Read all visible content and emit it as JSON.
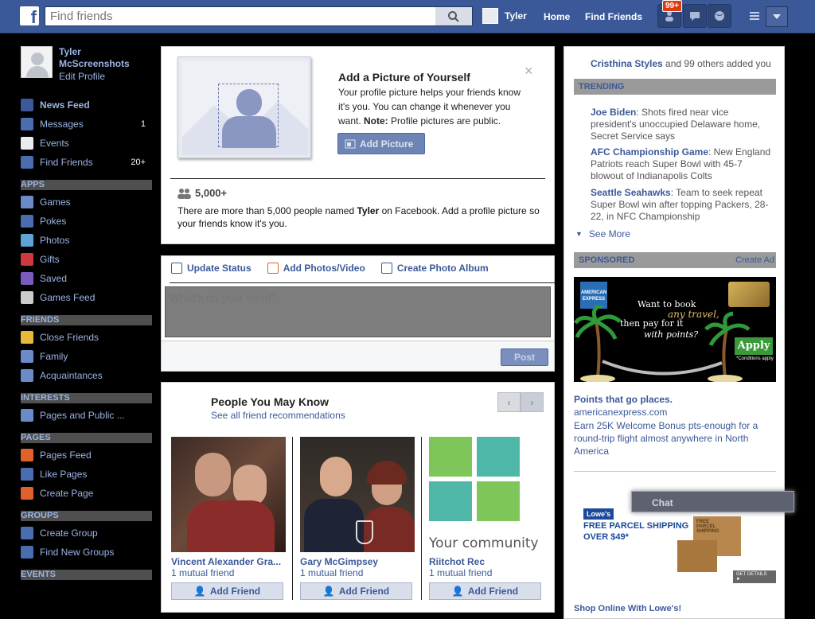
{
  "topbar": {
    "logo": "f",
    "search_placeholder": "Find friends",
    "user_name": "Tyler",
    "home": "Home",
    "find_friends": "Find Friends",
    "notif_count": "99+"
  },
  "sidebar": {
    "profile_name": "Tyler McScreenshots",
    "edit_profile": "Edit Profile",
    "main": [
      {
        "label": "News Feed",
        "count": "",
        "icon": "news-feed-icon",
        "color": "#3b5998"
      },
      {
        "label": "Messages",
        "count": "1",
        "icon": "messages-icon",
        "color": "#4a6db0"
      },
      {
        "label": "Events",
        "count": "",
        "icon": "events-icon",
        "color": "#e9ebee"
      },
      {
        "label": "Find Friends",
        "count": "20+",
        "icon": "find-friends-icon",
        "color": "#4a6db0"
      }
    ],
    "apps_heading": "APPS",
    "apps": [
      {
        "label": "Games",
        "icon": "games-icon",
        "color": "#6a8ac8"
      },
      {
        "label": "Pokes",
        "icon": "pokes-icon",
        "color": "#4a6db0"
      },
      {
        "label": "Photos",
        "icon": "photos-icon",
        "color": "#5fa4d6"
      },
      {
        "label": "Gifts",
        "icon": "gifts-icon",
        "color": "#d0393b"
      },
      {
        "label": "Saved",
        "icon": "saved-icon",
        "color": "#7a5bbf"
      },
      {
        "label": "Games Feed",
        "icon": "games-feed-icon",
        "color": "#cccccc"
      }
    ],
    "friends_heading": "FRIENDS",
    "friends": [
      {
        "label": "Close Friends",
        "icon": "close-friends-icon",
        "color": "#e8b93a"
      },
      {
        "label": "Family",
        "icon": "family-icon",
        "color": "#6a8ac8"
      },
      {
        "label": "Acquaintances",
        "icon": "acquaintances-icon",
        "color": "#6a8ac8"
      }
    ],
    "interests_heading": "INTERESTS",
    "interests": [
      {
        "label": "Pages and Public ...",
        "icon": "pages-public-icon",
        "color": "#6a8ac8"
      }
    ],
    "pages_heading": "PAGES",
    "pages": [
      {
        "label": "Pages Feed",
        "icon": "pages-feed-icon",
        "color": "#e0622a"
      },
      {
        "label": "Like Pages",
        "icon": "like-pages-icon",
        "color": "#4a6db0"
      },
      {
        "label": "Create Page",
        "icon": "create-page-icon",
        "color": "#e0622a"
      }
    ],
    "groups_heading": "GROUPS",
    "groups": [
      {
        "label": "Create Group",
        "icon": "create-group-icon",
        "color": "#4a6db0"
      },
      {
        "label": "Find New Groups",
        "icon": "find-groups-icon",
        "color": "#4a6db0"
      }
    ],
    "events_heading": "EVENTS"
  },
  "picture_panel": {
    "title": "Add a Picture of Yourself",
    "desc_plain": "Your profile picture helps your friends know it's you. You can change it whenever you want. ",
    "desc_note": "Note:",
    "desc_after": " Profile pictures are public.",
    "button": "Add Picture",
    "stat": "5,000+",
    "stat_desc_before": "There are more than 5,000 people named ",
    "stat_desc_name": "Tyler",
    "stat_desc_after": " on Facebook. Add a profile picture so your friends know it's you."
  },
  "composer": {
    "tabs": [
      "Update Status",
      "Add Photos/Video",
      "Create Photo Album"
    ],
    "placeholder": "What's on your mind?",
    "post": "Post"
  },
  "pymk": {
    "title": "People You May Know",
    "subtitle": "See all friend recommendations",
    "cards": [
      {
        "name": "Vincent Alexander Gra...",
        "mutual": "1 mutual friend",
        "action": "Add Friend"
      },
      {
        "name": "Gary McGimpsey",
        "mutual": "1 mutual friend",
        "action": "Add Friend"
      },
      {
        "name": "Riitchot Rec",
        "mutual": "1 mutual friend",
        "action": "Add Friend"
      }
    ],
    "community_text": "Your community e"
  },
  "right": {
    "ticker_name": "Cristhina Styles",
    "ticker_rest": " and 99 others added you",
    "trending_heading": "TRENDING",
    "trending": [
      {
        "topic": "Joe Biden",
        "text": ": Shots fired near vice president's unoccupied Delaware home, Secret Service says"
      },
      {
        "topic": "AFC Championship Game",
        "text": ": New England Patriots reach Super Bowl with 45-7 blowout of Indianapolis Colts"
      },
      {
        "topic": "Seattle Seahawks",
        "text": ": Team to seek repeat Super Bowl win after topping Packers, 28-22, in NFC Championship"
      }
    ],
    "see_more": "See More",
    "sponsored_heading": "SPONSORED",
    "create_ad": "Create Ad",
    "amex": {
      "line1": "Want to book",
      "line2": "any travel,",
      "line3": "then pay for it",
      "line4": "with points?",
      "apply": "Apply",
      "cond": "*Conditions apply",
      "logo": "AMERICAN EXPRESS"
    },
    "ad_title": "Points that go places.",
    "ad_url": "americanexpress.com",
    "ad_text": "Earn 25K Welcome Bonus pts-enough for a round-trip flight almost anywhere in North America",
    "lowes_logo": "Lowe's",
    "lowes_l1": "FREE PARCEL SHIPPING",
    "lowes_l2": "OVER $49*",
    "lowes_details": "GET DETAILS ►",
    "lowes_box": "FREE PARCEL SHIPPING",
    "lowes_foot": "Shop Online With Lowe's!"
  },
  "chat": {
    "label": "Chat"
  }
}
